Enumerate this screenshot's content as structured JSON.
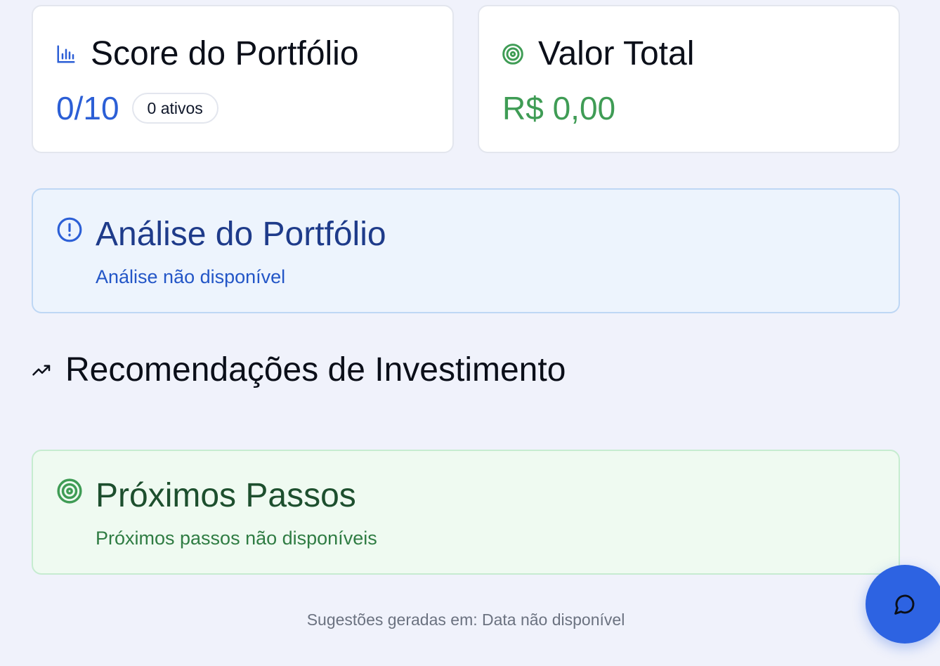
{
  "score_card": {
    "title": "Score do Portfólio",
    "icon": "bar-chart-icon",
    "value": "0/10",
    "badge": "0 ativos"
  },
  "total_card": {
    "title": "Valor Total",
    "icon": "target-icon",
    "value": "R$ 0,00"
  },
  "analysis": {
    "title": "Análise do Portfólio",
    "icon": "alert-circle-icon",
    "text": "Análise não disponível"
  },
  "recommendations": {
    "title": "Recomendações de Investimento",
    "icon": "trending-up-icon"
  },
  "next_steps": {
    "title": "Próximos Passos",
    "icon": "target-icon",
    "text": "Próximos passos não disponíveis"
  },
  "footer": {
    "text": "Sugestões geradas em: Data não disponível"
  },
  "chat_button": {
    "icon": "message-circle-icon"
  },
  "colors": {
    "accent_blue": "#2c5fd6",
    "success_green": "#3f9c55",
    "background": "#f0f2fb"
  }
}
